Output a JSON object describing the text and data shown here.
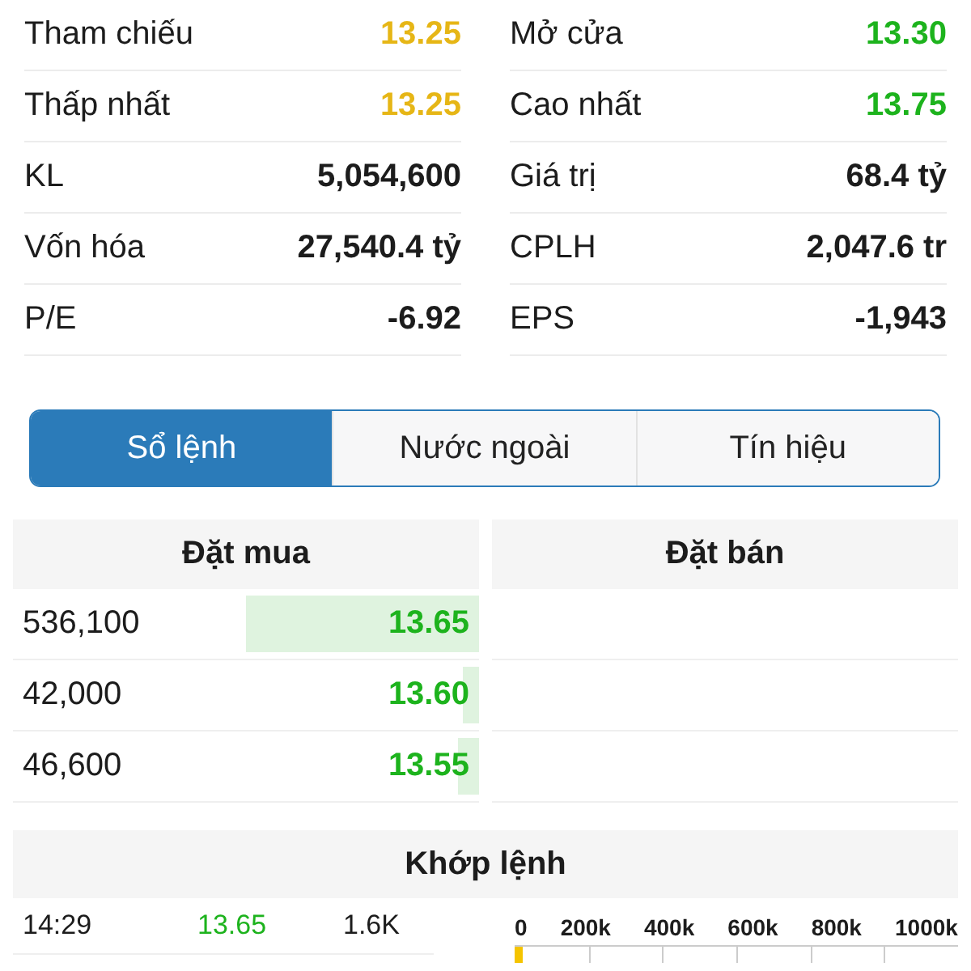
{
  "stats": [
    {
      "label": "Tham chiếu",
      "value": "13.25",
      "color": "#e6b616"
    },
    {
      "label": "Mở cửa",
      "value": "13.30",
      "color": "#1db31d"
    },
    {
      "label": "Thấp nhất",
      "value": "13.25",
      "color": "#e6b616"
    },
    {
      "label": "Cao nhất",
      "value": "13.75",
      "color": "#1db31d"
    },
    {
      "label": "KL",
      "value": "5,054,600",
      "color": "#1c1c1c"
    },
    {
      "label": "Giá trị",
      "value": "68.4 tỷ",
      "color": "#1c1c1c"
    },
    {
      "label": "Vốn hóa",
      "value": "27,540.4 tỷ",
      "color": "#1c1c1c"
    },
    {
      "label": "CPLH",
      "value": "2,047.6 tr",
      "color": "#1c1c1c"
    },
    {
      "label": "P/E",
      "value": "-6.92",
      "color": "#1c1c1c"
    },
    {
      "label": "EPS",
      "value": "-1,943",
      "color": "#1c1c1c"
    }
  ],
  "tabs": [
    {
      "label": "Sổ lệnh",
      "selected": true
    },
    {
      "label": "Nước ngoài",
      "selected": false
    },
    {
      "label": "Tín hiệu",
      "selected": false
    }
  ],
  "order_book": {
    "bid_title": "Đặt mua",
    "ask_title": "Đặt bán",
    "bids": [
      {
        "volume": "536,100",
        "price": "13.65",
        "level": 0.5
      },
      {
        "volume": "42,000",
        "price": "13.60",
        "level": 0.035
      },
      {
        "volume": "46,600",
        "price": "13.55",
        "level": 0.045
      }
    ]
  },
  "matches": {
    "title": "Khớp lệnh",
    "rows": [
      {
        "time": "14:29",
        "price": "13.65",
        "volume": "1.6K"
      }
    ],
    "volume_axis": [
      "0",
      "200k",
      "400k",
      "600k",
      "800k",
      "1000k"
    ]
  }
}
